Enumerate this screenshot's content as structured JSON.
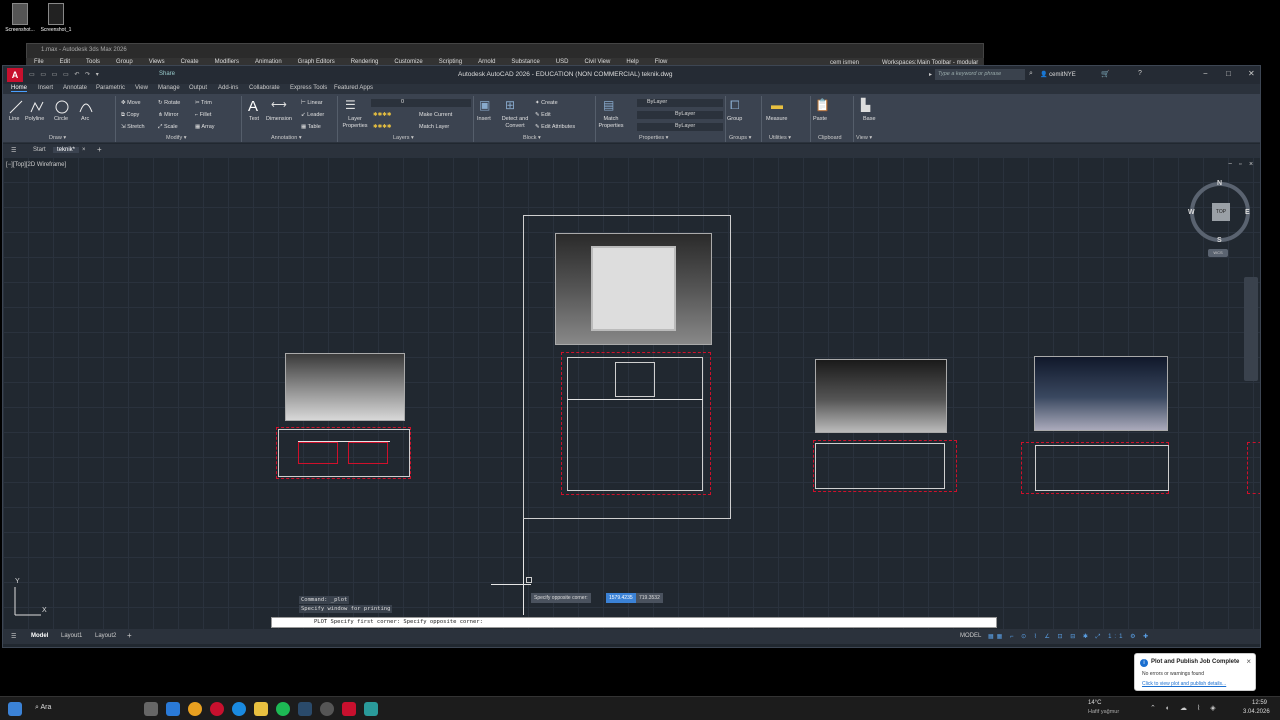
{
  "desktop": {
    "icons": [
      {
        "label": "Screenshot..."
      },
      {
        "label": "Screenshot_1"
      }
    ]
  },
  "max_window": {
    "title": "1.max - Autodesk 3ds Max 2026",
    "menu": [
      "File",
      "Edit",
      "Tools",
      "Group",
      "Views",
      "Create",
      "Modifiers",
      "Animation",
      "Graph Editors",
      "Rendering",
      "Customize",
      "Scripting",
      "Arnold",
      "Substance",
      "USD",
      "Civil View",
      "Help",
      "Flow"
    ],
    "user": "cem ismen",
    "workspace_label": "Workspaces:",
    "workspace_value": "Main Toolbar - modular"
  },
  "acad": {
    "title": "Autodesk AutoCAD 2026 - EDUCATION (NON COMMERCIAL)   teknik.dwg",
    "share": "Share",
    "search_placeholder": "Type a keyword or phrase",
    "user": "cemitNYE",
    "ribbon_tabs": [
      "Home",
      "Insert",
      "Annotate",
      "Parametric",
      "View",
      "Manage",
      "Output",
      "Add-ins",
      "Collaborate",
      "Express Tools",
      "Featured Apps"
    ],
    "ribbon": {
      "draw": {
        "line": "Line",
        "polyline": "Polyline",
        "circle": "Circle",
        "arc": "Arc",
        "panel": "Draw ▾"
      },
      "modify": {
        "move": "Move",
        "rotate": "Rotate",
        "trim": "Trim",
        "copy": "Copy",
        "mirror": "Mirror",
        "fillet": "Fillet",
        "stretch": "Stretch",
        "scale": "Scale",
        "array": "Array",
        "panel": "Modify ▾"
      },
      "annotation": {
        "text": "Text",
        "dimension": "Dimension",
        "linear": "Linear",
        "leader": "Leader",
        "table": "Table",
        "panel": "Annotation ▾"
      },
      "layers": {
        "props": "Layer Properties",
        "layer_value": "0",
        "make_current": "Make Current",
        "match_layer": "Match Layer",
        "panel": "Layers ▾"
      },
      "block": {
        "insert": "Insert",
        "detect": "Detect and Convert",
        "create": "Create",
        "edit": "Edit",
        "edit_attributes": "Edit Attributes",
        "panel": "Block ▾"
      },
      "properties": {
        "match": "Match Properties",
        "bylayer1": "ByLayer",
        "bylayer2": "ByLayer",
        "bylayer3": "ByLayer",
        "panel": "Properties ▾"
      },
      "groups": {
        "group": "Group",
        "panel": "Groups ▾"
      },
      "utilities": {
        "measure": "Measure",
        "panel": "Utilities ▾"
      },
      "clipboard": {
        "paste": "Paste",
        "panel": "Clipboard"
      },
      "view": {
        "base": "Base",
        "panel": "View ▾"
      }
    },
    "file_tabs": [
      "Start",
      "teknik*"
    ],
    "viewport_label": "[−][Top][2D Wireframe]",
    "navcube": {
      "top": "TOP",
      "n": "N",
      "s": "S",
      "e": "E",
      "w": "W",
      "wcs": "WCS"
    },
    "tooltip": {
      "prompt": "Specify opposite corner:",
      "x": "1579.4235",
      "y": "719.3532"
    },
    "command_history": [
      "Command: _plot",
      "Specify window for printing"
    ],
    "command_line": "PLOT Specify first corner: Specify opposite corner:",
    "ucs": {
      "x": "X",
      "y": "Y"
    },
    "layout_tabs": [
      "Model",
      "Layout1",
      "Layout2"
    ],
    "status_model": "MODEL",
    "notification": {
      "title": "Plot and Publish Job Complete",
      "message": "No errors or warnings found",
      "link": "Click to view plot and publish details..."
    }
  },
  "taskbar": {
    "search": "Ara",
    "weather_temp": "14°C",
    "weather_desc": "Hafif yağmur",
    "time": "12:59",
    "date": "3.04.2026"
  }
}
